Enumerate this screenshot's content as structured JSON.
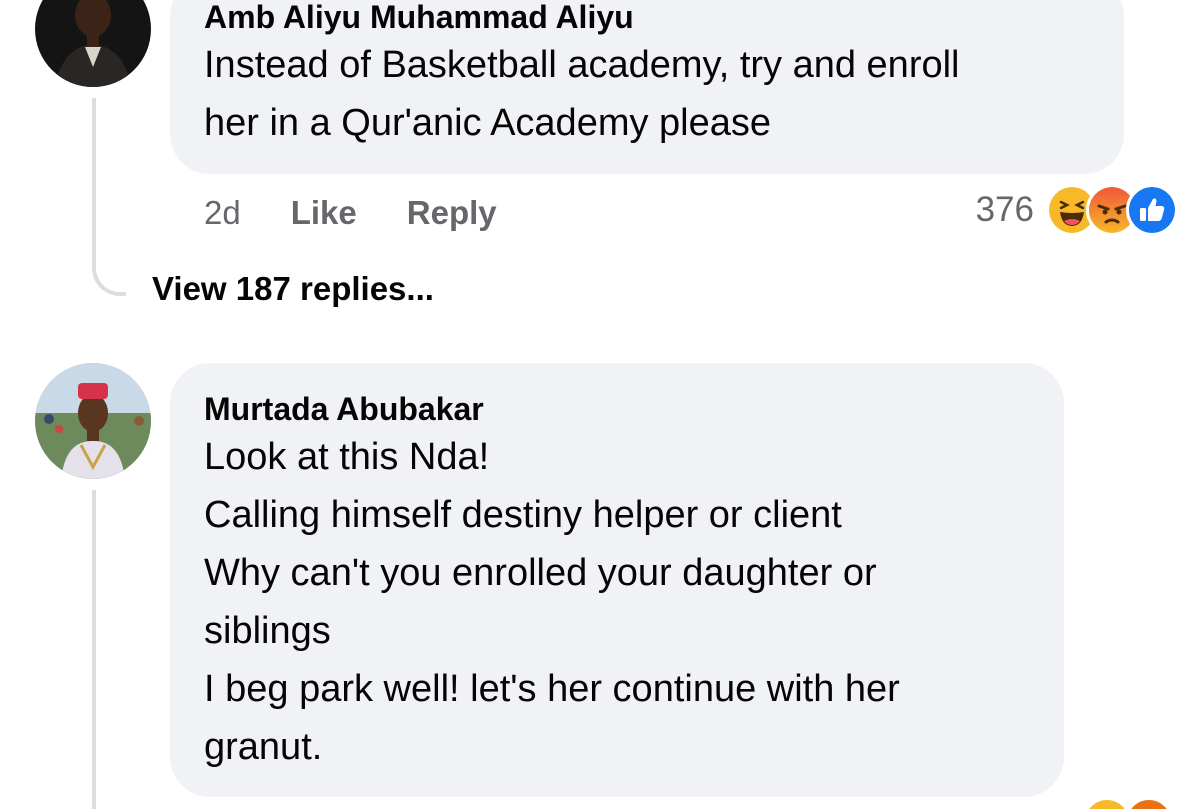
{
  "comment1": {
    "author": "Amb Aliyu Muhammad Aliyu",
    "lines": [
      "Instead of Basketball academy, try and enroll",
      "her in a Qur'anic Academy please"
    ],
    "time": "2d",
    "like_label": "Like",
    "reply_label": "Reply",
    "reaction_count": "376",
    "reactions": [
      "haha-icon",
      "angry-icon",
      "like-icon"
    ],
    "view_replies": "View 187 replies..."
  },
  "comment2": {
    "author": "Murtada Abubakar",
    "lines": [
      "Look at this Nda!",
      "Calling himself destiny helper or client",
      "Why can't you enrolled your daughter or",
      "siblings",
      "I beg park well! let's her continue with her",
      "granut."
    ]
  },
  "colors": {
    "bubble": "#f0f2f5",
    "secondary_text": "#65676b",
    "thread_line": "#dadde1",
    "like_blue": "#1877f2",
    "haha_yellow": "#f7b928",
    "angry_orange": "#e9710f"
  }
}
